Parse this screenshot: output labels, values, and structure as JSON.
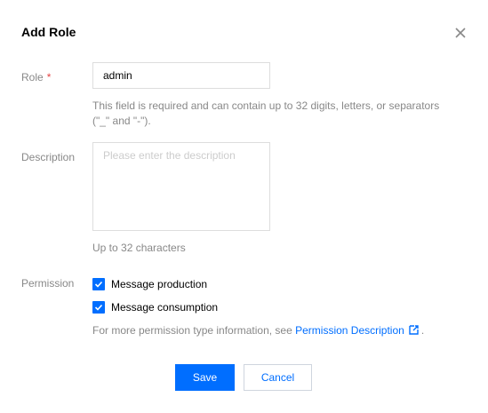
{
  "dialog": {
    "title": "Add Role"
  },
  "form": {
    "role": {
      "label": "Role",
      "required_mark": "*",
      "value": "admin",
      "help": "This field is required and can contain up to 32 digits, letters, or separators",
      "help_line2": "(\"_\" and \"-\")."
    },
    "description": {
      "label": "Description",
      "placeholder": "Please enter the description",
      "value": "",
      "help": "Up to 32 characters"
    },
    "permission": {
      "label": "Permission",
      "options": [
        {
          "label": "Message production",
          "checked": true
        },
        {
          "label": "Message consumption",
          "checked": true
        }
      ],
      "info_prefix": "For more permission type information, see",
      "info_link": "Permission Description",
      "info_suffix": "."
    }
  },
  "actions": {
    "save_label": "Save",
    "cancel_label": "Cancel"
  },
  "colors": {
    "primary": "#006eff",
    "required": "#e54545",
    "label": "#888888"
  },
  "icons": {
    "close": "close-icon",
    "checkbox": "checkmark-icon",
    "external_link": "external-link-icon"
  }
}
